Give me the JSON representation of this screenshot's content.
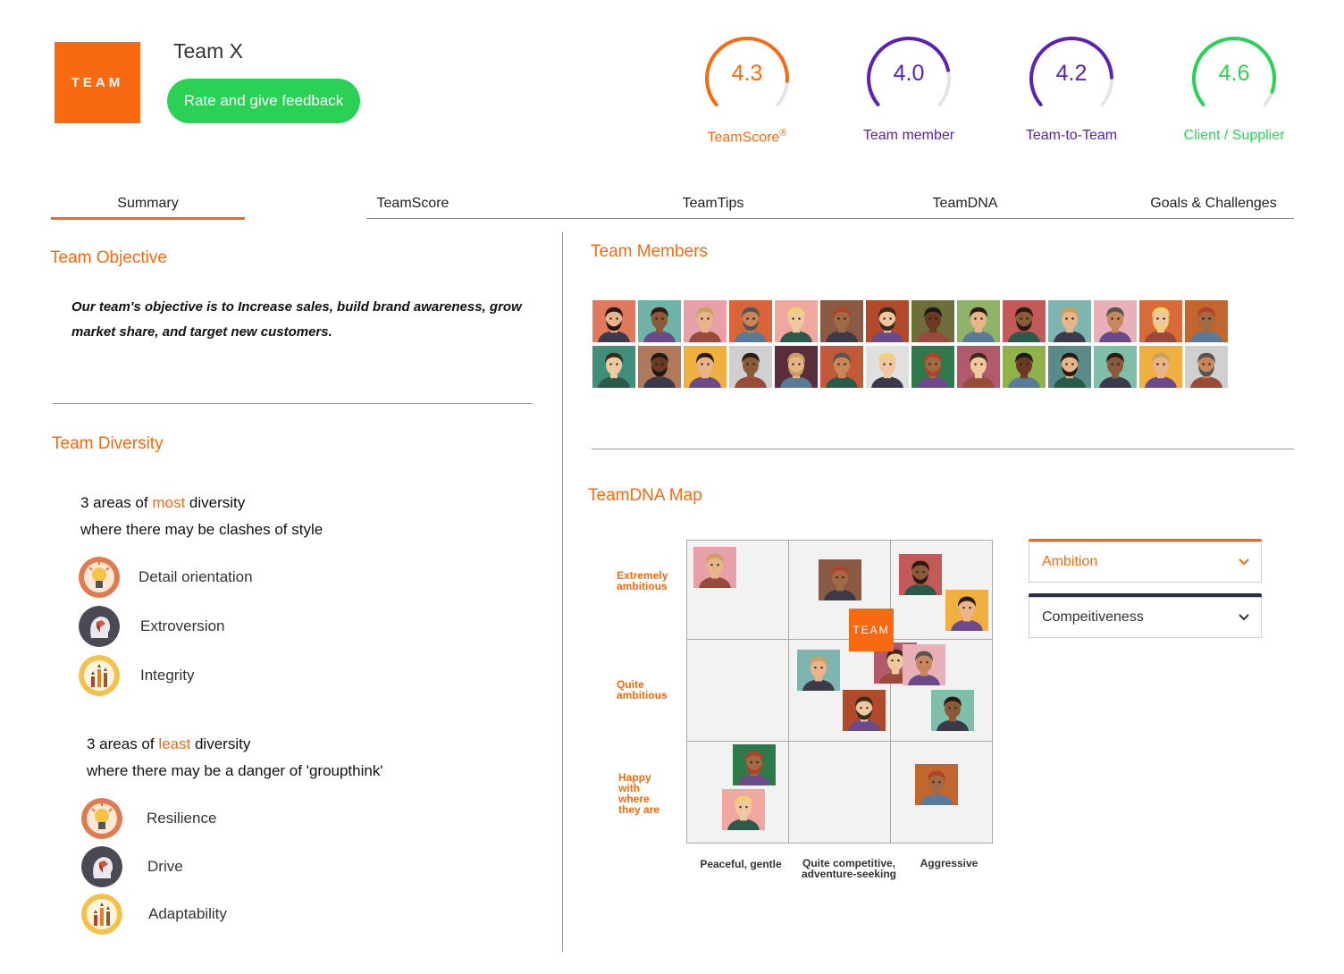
{
  "header": {
    "logo_text": "TEAM",
    "team_name": "Team X",
    "rate_button": "Rate and give feedback"
  },
  "scores": [
    {
      "value": "4.3",
      "label": "TeamScore",
      "mark": "®",
      "color": "#f86a12",
      "fill": 0.86
    },
    {
      "value": "4.0",
      "label": "Team member",
      "color": "#5b21b6",
      "fill": 0.8
    },
    {
      "value": "4.2",
      "label": "Team-to-Team",
      "color": "#5b21b6",
      "fill": 0.84
    },
    {
      "value": "4.6",
      "label": "Client / Supplier",
      "color": "#2bd155",
      "fill": 0.92
    }
  ],
  "tabs": [
    "Summary",
    "TeamScore",
    "TeamTips",
    "TeamDNA",
    "Goals & Challenges"
  ],
  "active_tab": "Summary",
  "objective": {
    "title": "Team Objective",
    "text": "Our team's objective is to Increase sales, build brand awareness, grow market share, and target new customers."
  },
  "diversity": {
    "title": "Team Diversity",
    "most": {
      "prefix": "3 areas of ",
      "highlight": "most",
      "suffix": " diversity",
      "line2": "where there may be clashes of style",
      "items": [
        "Detail orientation",
        "Extroversion",
        "Integrity"
      ]
    },
    "least": {
      "prefix": "3 areas of ",
      "highlight": "least",
      "suffix": " diversity",
      "line2": "where there may be a danger of 'groupthink'",
      "items": [
        "Resilience",
        "Drive",
        "Adaptability"
      ]
    }
  },
  "members": {
    "title": "Team Members"
  },
  "dna_map": {
    "title": "TeamDNA Map",
    "team_marker": "TEAM",
    "y_labels": [
      "Extremely ambitious",
      "Quite ambitious",
      "Happy with where they are"
    ],
    "x_labels": [
      "Peaceful, gentle",
      "Quite competitive, adventure-seeking",
      "Aggressive"
    ],
    "select_1": "Ambition",
    "select_2": "Compeitiveness"
  },
  "colors": {
    "accent": "#f86a12",
    "green": "#2bd155",
    "purple": "#5b21b6",
    "navy": "#2b2d42"
  }
}
